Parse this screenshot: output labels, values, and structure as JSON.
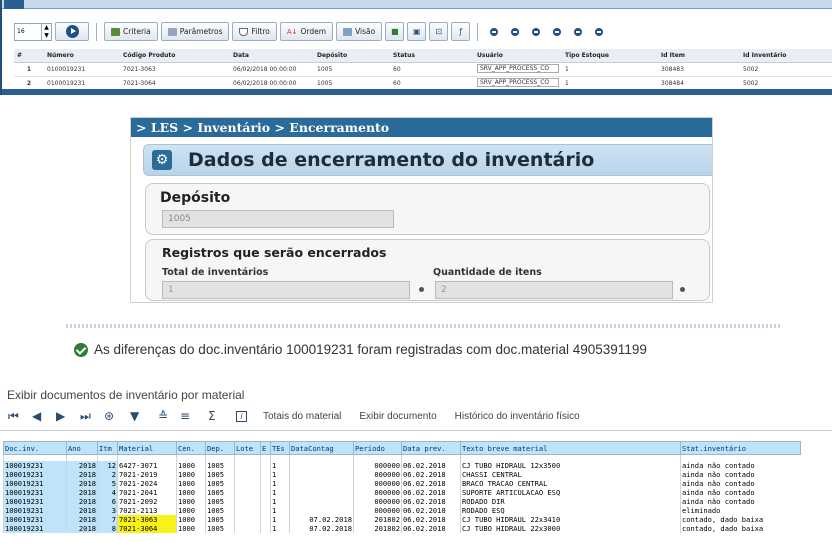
{
  "grid_panel": {
    "page_size": "16",
    "buttons": {
      "criteria": "Criteria",
      "parametros": "Parâmetros",
      "filtro": "Filtro",
      "ordem": "Ordem",
      "visao": "Visão"
    },
    "columns": [
      "#",
      "Número",
      "Código Produto",
      "Data",
      "Depósito",
      "Status",
      "Usuário",
      "Tipo Estoque",
      "Id Item",
      "Id Inventário"
    ],
    "rows": [
      {
        "n": "1",
        "numero": "0100019231",
        "codigo": "7021-3063",
        "data": "06/02/2018 00:00:00",
        "deposito": "1005",
        "status": "60",
        "usuario": "SRV_APP_PROCESS_CO",
        "tipo": "1",
        "id_item": "308483",
        "id_inv": "5002"
      },
      {
        "n": "2",
        "numero": "0100019231",
        "codigo": "7021-3064",
        "data": "06/02/2018 00:00:00",
        "deposito": "1005",
        "status": "60",
        "usuario": "SRV_APP_PROCESS_CO",
        "tipo": "1",
        "id_item": "308484",
        "id_inv": "5002"
      }
    ]
  },
  "les_form": {
    "breadcrumb": "> LES > Inventário > Encerramento",
    "title": "Dados de encerramento do inventário",
    "deposito_label": "Depósito",
    "deposito_value": "1005",
    "registros_label": "Registros que serão encerrados",
    "total_label": "Total de inventários",
    "total_value": "1",
    "quantidade_label": "Quantidade de itens",
    "quantidade_value": "2"
  },
  "message": {
    "text": "As diferenças do doc.inventário 100019231 foram registradas com doc.material 4905391199",
    "color": "#2f7d32"
  },
  "sap_list": {
    "title": "Exibir documentos de inventário por material",
    "toolbar": {
      "totais": "Totais do material",
      "exibir": "Exibir documento",
      "historico": "Histórico do inventário físico"
    },
    "columns": [
      "Doc.inv.",
      "Ano",
      "Itm",
      "Material",
      "Cen.",
      "Dep.",
      "Lote",
      "E",
      "TEs",
      "DataContag",
      "Período",
      "Data prev.",
      "Texto breve material",
      "Stat.inventário"
    ],
    "rows": [
      {
        "doc": "100019231",
        "ano": "2018",
        "itm": "12",
        "mat": "6427-3071",
        "cen": "1000",
        "dep": "1005",
        "lote": "",
        "e": "",
        "tes": "1",
        "contag": "",
        "per": "000000",
        "prev": "06.02.2018",
        "texto": "CJ TUBO HIDRAUL 12x3500",
        "stat": "ainda não contado",
        "hl": false
      },
      {
        "doc": "100019231",
        "ano": "2018",
        "itm": "2",
        "mat": "7021-2019",
        "cen": "1000",
        "dep": "1005",
        "lote": "",
        "e": "",
        "tes": "1",
        "contag": "",
        "per": "000000",
        "prev": "06.02.2018",
        "texto": "CHASSI CENTRAL",
        "stat": "ainda não contado",
        "hl": false
      },
      {
        "doc": "100019231",
        "ano": "2018",
        "itm": "5",
        "mat": "7021-2024",
        "cen": "1000",
        "dep": "1005",
        "lote": "",
        "e": "",
        "tes": "1",
        "contag": "",
        "per": "000000",
        "prev": "06.02.2018",
        "texto": "BRACO TRACAO CENTRAL",
        "stat": "ainda não contado",
        "hl": false
      },
      {
        "doc": "100019231",
        "ano": "2018",
        "itm": "4",
        "mat": "7021-2041",
        "cen": "1000",
        "dep": "1005",
        "lote": "",
        "e": "",
        "tes": "1",
        "contag": "",
        "per": "000000",
        "prev": "06.02.2018",
        "texto": "SUPORTE ARTICULACAO ESQ",
        "stat": "ainda não contado",
        "hl": false
      },
      {
        "doc": "100019231",
        "ano": "2018",
        "itm": "6",
        "mat": "7021-2092",
        "cen": "1000",
        "dep": "1005",
        "lote": "",
        "e": "",
        "tes": "1",
        "contag": "",
        "per": "000000",
        "prev": "06.02.2018",
        "texto": "RODADO DIR",
        "stat": "ainda não contado",
        "hl": false
      },
      {
        "doc": "100019231",
        "ano": "2018",
        "itm": "3",
        "mat": "7021-2113",
        "cen": "1000",
        "dep": "1005",
        "lote": "",
        "e": "",
        "tes": "1",
        "contag": "",
        "per": "000000",
        "prev": "06.02.2018",
        "texto": "RODADO ESQ",
        "stat": "eliminado",
        "hl": false
      },
      {
        "doc": "100019231",
        "ano": "2018",
        "itm": "7",
        "mat": "7021-3063",
        "cen": "1000",
        "dep": "1005",
        "lote": "",
        "e": "",
        "tes": "1",
        "contag": "07.02.2018",
        "per": "201802",
        "prev": "06.02.2018",
        "texto": "CJ TUBO HIDRAUL 22x3410",
        "stat": "contado, dado baixa",
        "hl": true
      },
      {
        "doc": "100019231",
        "ano": "2018",
        "itm": "8",
        "mat": "7021-3064",
        "cen": "1000",
        "dep": "1005",
        "lote": "",
        "e": "",
        "tes": "1",
        "contag": "07.02.2018",
        "per": "201802",
        "prev": "06.02.2018",
        "texto": "CJ TUBO HIDRAUL 22x3000",
        "stat": "contado, dado baixa",
        "hl": true
      }
    ],
    "highlight_color": "#f7f31a"
  }
}
